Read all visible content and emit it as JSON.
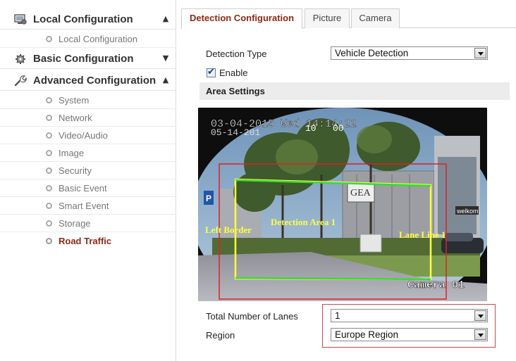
{
  "sidebar": {
    "local": {
      "label": "Local Configuration",
      "icon": "monitor-settings-icon",
      "expanded": true,
      "items": [
        {
          "label": "Local Configuration"
        }
      ]
    },
    "basic": {
      "label": "Basic Configuration",
      "icon": "gear-icon",
      "expanded": false
    },
    "advanced": {
      "label": "Advanced Configuration",
      "icon": "wrench-icon",
      "expanded": true,
      "items": [
        {
          "label": "System"
        },
        {
          "label": "Network"
        },
        {
          "label": "Video/Audio"
        },
        {
          "label": "Image"
        },
        {
          "label": "Security"
        },
        {
          "label": "Basic Event"
        },
        {
          "label": "Smart Event"
        },
        {
          "label": "Storage"
        },
        {
          "label": "Road Traffic",
          "active": true
        }
      ]
    }
  },
  "tabs": [
    {
      "label": "Detection Configuration",
      "active": true
    },
    {
      "label": "Picture"
    },
    {
      "label": "Camera"
    }
  ],
  "form": {
    "detection_type_label": "Detection Type",
    "detection_type_value": "Vehicle Detection",
    "enable_label": "Enable",
    "enable_checked": true,
    "area_settings_title": "Area Settings",
    "lanes_label": "Total Number of Lanes",
    "lanes_value": "1",
    "region_label": "Region",
    "region_value": "Europe Region"
  },
  "video": {
    "osd_time": "03-04-2015 Wed 14:14:22",
    "osd_time_ghost": "05-14-201",
    "osd_ghost_numbers": "10   00",
    "camera_name": "Camera 01",
    "left_border_label": "Left Border",
    "detection_area_label": "Detection Area 1",
    "lane_line_label": "Lane Line 1",
    "sign_text_1": "GEA",
    "sign_text_2": "welkom"
  },
  "colors": {
    "accent": "#8b2a16",
    "detection_area": "#ffff3a",
    "lane_line": "#33dd33",
    "region_box": "#e02020",
    "highlight_box": "#c94a4a"
  }
}
